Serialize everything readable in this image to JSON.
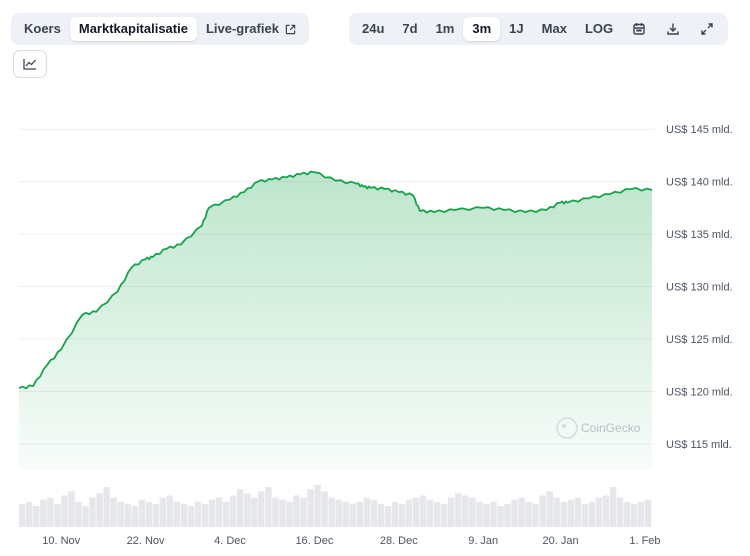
{
  "tabs": [
    {
      "label": "Koers",
      "active": false
    },
    {
      "label": "Marktkapitalisatie",
      "active": true
    },
    {
      "label": "Live-grafiek",
      "active": false
    }
  ],
  "ranges": [
    {
      "label": "24u",
      "active": false
    },
    {
      "label": "7d",
      "active": false
    },
    {
      "label": "1m",
      "active": false
    },
    {
      "label": "3m",
      "active": true
    },
    {
      "label": "1J",
      "active": false
    },
    {
      "label": "Max",
      "active": false
    },
    {
      "label": "LOG",
      "active": false
    }
  ],
  "icons": {
    "external": "external-link-icon",
    "calendar": "calendar-icon",
    "download": "download-icon",
    "expand": "expand-icon",
    "chart_toggle": "line-chart-icon"
  },
  "watermark": "CoinGecko",
  "colors": {
    "line": "#16a34a",
    "fill": "#16a34a",
    "grid": "#eceff3",
    "volume": "#e5e7eb"
  },
  "chart_data": {
    "type": "line",
    "ylim": [
      112.5,
      147.5
    ],
    "yticks": [
      145,
      140,
      135,
      130,
      125,
      120,
      115
    ],
    "ytick_labels": [
      "US$ 145 mld.",
      "US$ 140 mld.",
      "US$ 135 mld.",
      "US$ 130 mld.",
      "US$ 125 mld.",
      "US$ 120 mld.",
      "US$ 115 mld."
    ],
    "x_range": [
      "2024-11-04",
      "2025-02-02"
    ],
    "xticks": [
      "2024-11-10",
      "2024-11-22",
      "2024-12-04",
      "2024-12-16",
      "2024-12-28",
      "2025-01-09",
      "2025-01-20",
      "2025-02-01"
    ],
    "xtick_labels": [
      "10. Nov",
      "22. Nov",
      "4. Dec",
      "16. Dec",
      "28. Dec",
      "9. Jan",
      "20. Jan",
      "1. Feb"
    ],
    "series": [
      {
        "x": [
          "2024-11-04",
          "2024-11-06",
          "2024-11-08",
          "2024-11-10",
          "2024-11-13",
          "2024-11-15",
          "2024-11-18",
          "2024-11-20",
          "2024-11-22",
          "2024-11-23",
          "2024-11-25",
          "2024-11-27",
          "2024-11-30",
          "2024-12-01",
          "2024-12-04",
          "2024-12-06",
          "2024-12-08",
          "2024-12-10",
          "2024-12-12",
          "2024-12-14",
          "2024-12-16",
          "2024-12-19",
          "2024-12-22",
          "2024-12-23",
          "2024-12-24",
          "2024-12-26",
          "2024-12-28",
          "2024-12-30",
          "2024-12-31",
          "2025-01-02",
          "2025-01-05",
          "2025-01-09",
          "2025-01-12",
          "2025-01-15",
          "2025-01-18",
          "2025-01-20",
          "2025-01-21",
          "2025-01-24",
          "2025-01-27",
          "2025-01-30",
          "2025-02-02"
        ],
        "y": [
          120.3,
          120.5,
          122.5,
          124.0,
          127.3,
          127.6,
          129.5,
          131.8,
          132.6,
          132.8,
          133.6,
          134.0,
          135.8,
          137.5,
          138.3,
          139.0,
          140.0,
          140.2,
          140.4,
          140.7,
          140.9,
          140.1,
          139.8,
          139.5,
          139.4,
          139.3,
          139.0,
          138.7,
          137.2,
          137.1,
          137.3,
          137.5,
          137.3,
          137.1,
          137.3,
          138.0,
          138.0,
          138.4,
          138.8,
          139.3,
          139.2
        ]
      }
    ],
    "volume": [
      0.55,
      0.6,
      0.5,
      0.65,
      0.7,
      0.55,
      0.75,
      0.85,
      0.6,
      0.5,
      0.7,
      0.8,
      0.95,
      0.7,
      0.6,
      0.55,
      0.5,
      0.65,
      0.6,
      0.55,
      0.7,
      0.75,
      0.6,
      0.55,
      0.5,
      0.6,
      0.55,
      0.65,
      0.7,
      0.6,
      0.75,
      0.9,
      0.8,
      0.7,
      0.85,
      0.95,
      0.7,
      0.65,
      0.6,
      0.75,
      0.7,
      0.9,
      1.0,
      0.85,
      0.7,
      0.65,
      0.6,
      0.55,
      0.6,
      0.7,
      0.65,
      0.55,
      0.5,
      0.6,
      0.55,
      0.65,
      0.7,
      0.75,
      0.65,
      0.6,
      0.55,
      0.7,
      0.8,
      0.75,
      0.7,
      0.6,
      0.55,
      0.6,
      0.5,
      0.55,
      0.65,
      0.7,
      0.6,
      0.55,
      0.75,
      0.85,
      0.7,
      0.6,
      0.65,
      0.7,
      0.55,
      0.6,
      0.7,
      0.75,
      0.95,
      0.7,
      0.6,
      0.55,
      0.6,
      0.65
    ]
  }
}
